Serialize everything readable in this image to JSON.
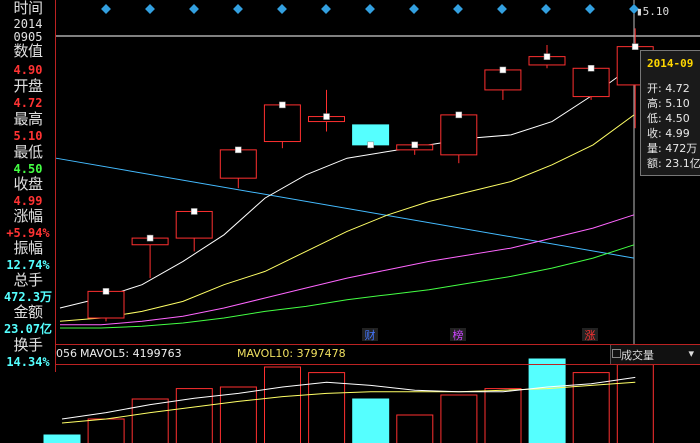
{
  "colors": {
    "up": "#ff3030",
    "down": "#55ffff",
    "ma5": "#ffffff",
    "ma10": "#ffff66",
    "ma20": "#ff66ff",
    "ma60": "#44ff44",
    "trendline": "#44bbff",
    "marker": "#33a0e0",
    "border": "#b22222"
  },
  "left_panel": {
    "time_label": "时间",
    "date_line1": "2014",
    "date_line2": "0905",
    "close_label": "数值",
    "close_value": "4.90",
    "open_label": "开盘",
    "open_value": "4.72",
    "high_label": "最高",
    "high_value": "5.10",
    "low_label": "最低",
    "low_value": "4.50",
    "shou_label": "收盘",
    "shou_value": "4.99",
    "change_label": "涨幅",
    "change_value": "+5.94%",
    "amp_label": "振幅",
    "amp_value": "12.74%",
    "hand_label": "总手",
    "hand_value": "472.3万",
    "amount_label": "金额",
    "amount_value": "23.07亿",
    "turnover_label": "换手",
    "turnover_value": "14.34%"
  },
  "price_chart": {
    "high_tag": "5.10",
    "event_labels": [
      "财",
      "榜",
      "涨"
    ],
    "candles": [
      {
        "o": 3.36,
        "c": 3.52,
        "h": 3.52,
        "l": 3.34
      },
      {
        "o": 3.8,
        "c": 3.84,
        "h": 3.86,
        "l": 3.6
      },
      {
        "o": 3.84,
        "c": 4.0,
        "h": 4.0,
        "l": 3.76
      },
      {
        "o": 4.2,
        "c": 4.37,
        "h": 4.37,
        "l": 4.14
      },
      {
        "o": 4.42,
        "c": 4.64,
        "h": 4.64,
        "l": 4.38
      },
      {
        "o": 4.54,
        "c": 4.57,
        "h": 4.73,
        "l": 4.48
      },
      {
        "o": 4.52,
        "c": 4.4,
        "h": 4.52,
        "l": 4.38
      },
      {
        "o": 4.37,
        "c": 4.4,
        "h": 4.42,
        "l": 4.34
      },
      {
        "o": 4.34,
        "c": 4.58,
        "h": 4.58,
        "l": 4.29
      },
      {
        "o": 4.73,
        "c": 4.85,
        "h": 4.85,
        "l": 4.67
      },
      {
        "o": 4.88,
        "c": 4.93,
        "h": 5.0,
        "l": 4.86
      },
      {
        "o": 4.69,
        "c": 4.86,
        "h": 4.86,
        "l": 4.67
      },
      {
        "o": 4.76,
        "c": 4.99,
        "h": 5.1,
        "l": 4.5
      }
    ],
    "ma5": [
      3.42,
      3.48,
      3.56,
      3.7,
      3.86,
      4.08,
      4.22,
      4.32,
      4.36,
      4.4,
      4.44,
      4.46,
      4.54,
      4.7,
      4.88
    ],
    "ma10": [
      3.34,
      3.36,
      3.4,
      3.46,
      3.56,
      3.64,
      3.76,
      3.88,
      3.98,
      4.06,
      4.12,
      4.18,
      4.28,
      4.4,
      4.58
    ],
    "ma20": [
      3.32,
      3.32,
      3.34,
      3.37,
      3.42,
      3.48,
      3.54,
      3.6,
      3.65,
      3.7,
      3.74,
      3.78,
      3.84,
      3.9,
      3.98
    ],
    "ma60": [
      3.3,
      3.3,
      3.31,
      3.33,
      3.36,
      3.4,
      3.43,
      3.47,
      3.5,
      3.53,
      3.57,
      3.61,
      3.66,
      3.72,
      3.8
    ],
    "trendline": [
      4.32,
      3.72
    ],
    "ylim": [
      3.3,
      5.15
    ]
  },
  "volume": {
    "left_value": "056",
    "ma5_label": "MAVOL5: 4199763",
    "ma10_label": "MAVOL10: 3797478",
    "indicator_select": "成交量",
    "bars": [
      {
        "v": 0.1,
        "up": false
      },
      {
        "v": 0.3,
        "up": true
      },
      {
        "v": 0.55,
        "up": true
      },
      {
        "v": 0.68,
        "up": true
      },
      {
        "v": 0.7,
        "up": true
      },
      {
        "v": 0.95,
        "up": true
      },
      {
        "v": 0.88,
        "up": true
      },
      {
        "v": 0.55,
        "up": false
      },
      {
        "v": 0.35,
        "up": true
      },
      {
        "v": 0.6,
        "up": true
      },
      {
        "v": 0.68,
        "up": true
      },
      {
        "v": 1.05,
        "up": false
      },
      {
        "v": 0.88,
        "up": true
      },
      {
        "v": 0.98,
        "up": true
      }
    ],
    "vma5": [
      0.3,
      0.38,
      0.48,
      0.56,
      0.62,
      0.7,
      0.76,
      0.72,
      0.66,
      0.64,
      0.64,
      0.7,
      0.74,
      0.82
    ],
    "vma10": [
      0.25,
      0.3,
      0.38,
      0.45,
      0.52,
      0.58,
      0.62,
      0.64,
      0.64,
      0.64,
      0.66,
      0.68,
      0.72,
      0.76
    ]
  },
  "tooltip": {
    "date": "2014-09",
    "open": "开: 4.72",
    "high": "高: 5.10",
    "low": "低: 4.50",
    "close": "收: 4.99",
    "volume": "量: 472万",
    "amount": "额: 23.1亿"
  }
}
